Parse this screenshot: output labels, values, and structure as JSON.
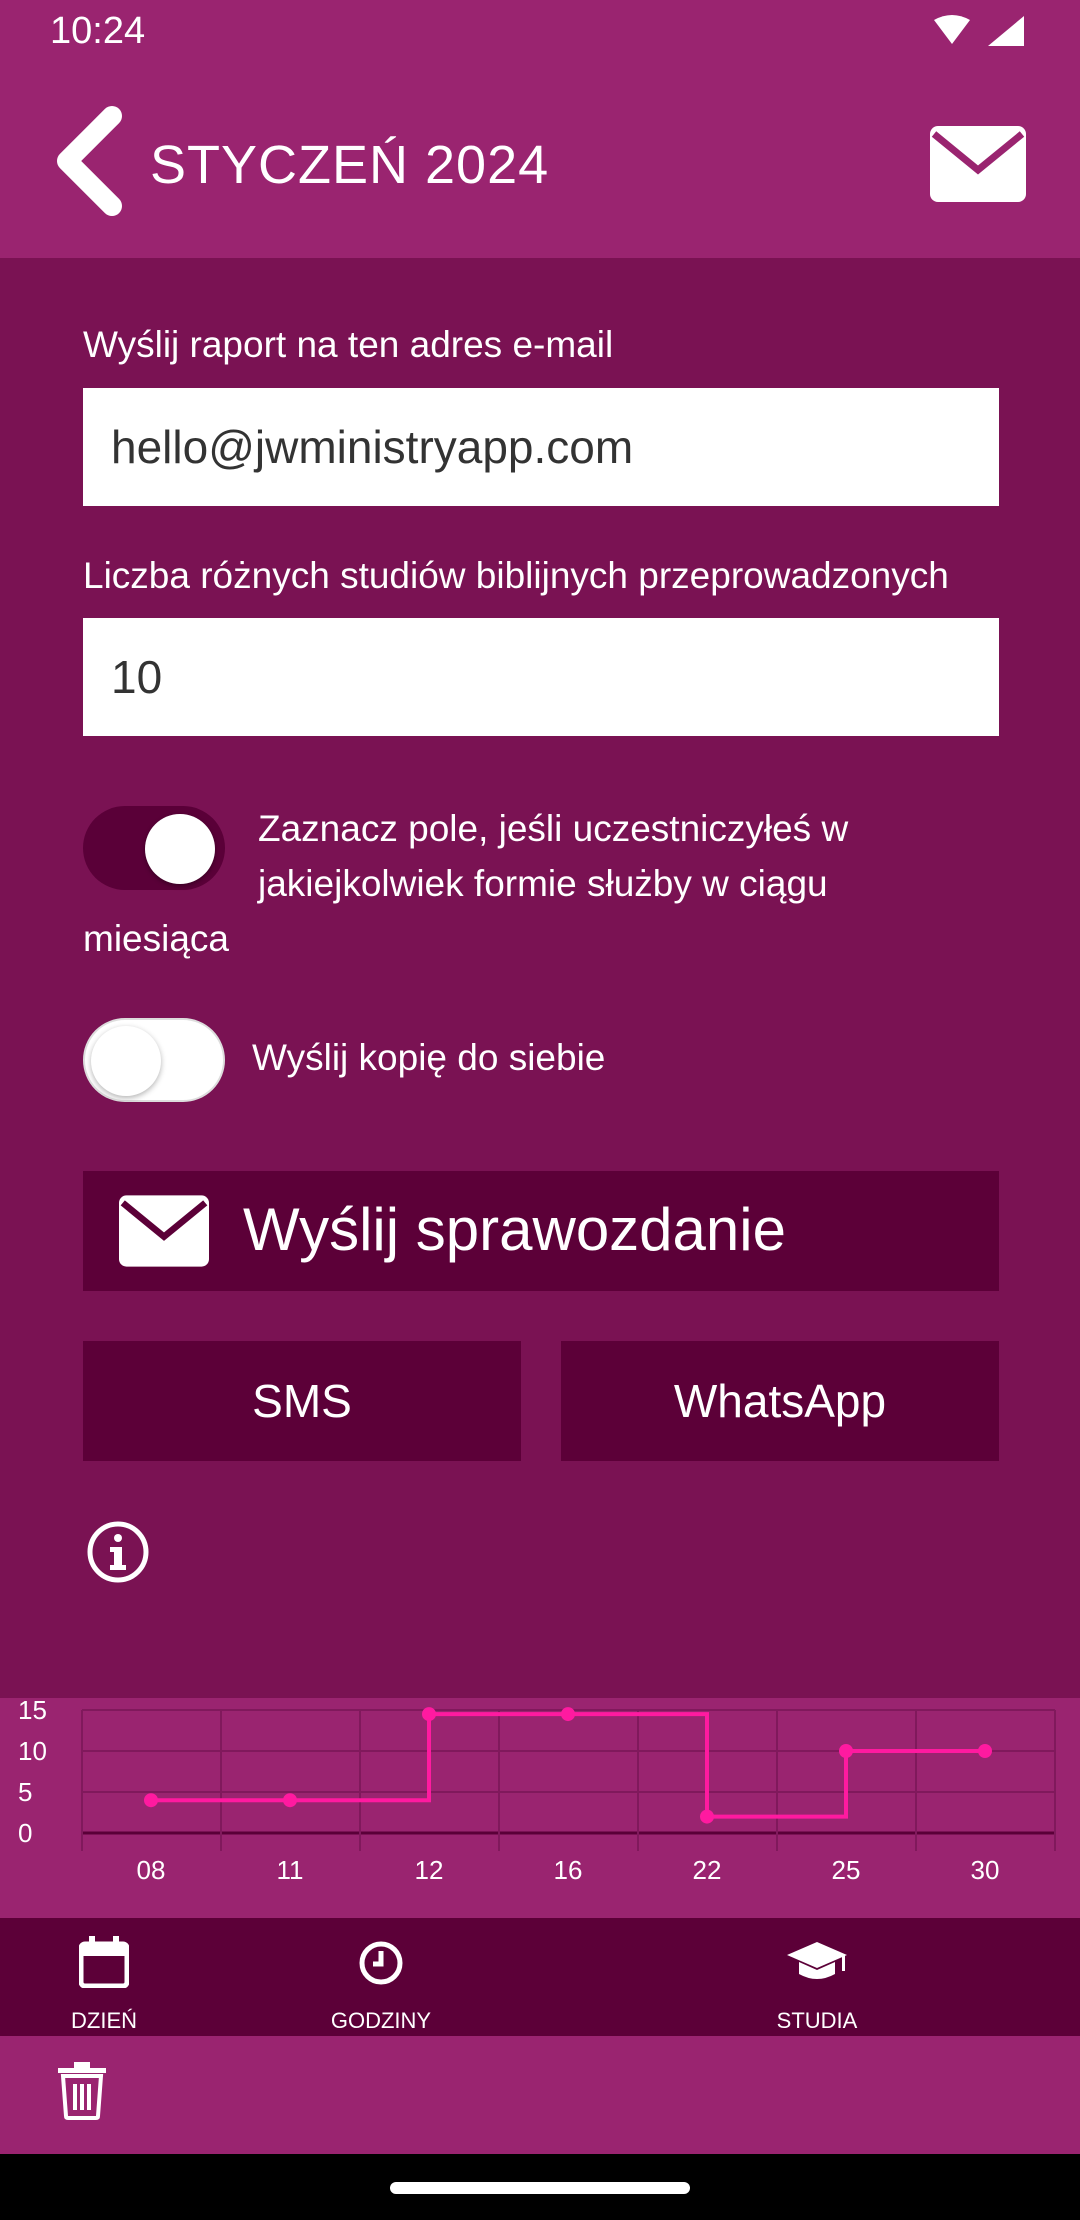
{
  "status_bar": {
    "time": "10:24"
  },
  "header": {
    "title": "STYCZEŃ 2024",
    "back_icon": "chevron-left-icon",
    "mail_icon": "envelope-icon"
  },
  "form": {
    "email_label": "Wyślij raport na ten adres e-mail",
    "email_value": "hello@jwministryapp.com",
    "studies_label": "Liczba różnych studiów biblijnych przeprowadzonych",
    "studies_value": "10",
    "participated_toggle": {
      "on": true,
      "label_line1": "Zaznacz pole, jeśli uczestniczyłeś w",
      "label_line2": "jakiejkolwiek formie służby w ciągu",
      "label_line3": "miesiąca"
    },
    "copy_toggle": {
      "on": false,
      "label": "Wyślij kopię do siebie"
    }
  },
  "actions": {
    "send_label": "Wyślij sprawozdanie",
    "sms_label": "SMS",
    "whatsapp_label": "WhatsApp"
  },
  "chart_data": {
    "type": "line",
    "step": true,
    "x": [
      "08",
      "11",
      "12",
      "16",
      "22",
      "25",
      "30"
    ],
    "series": [
      {
        "values": [
          4,
          4,
          14.5,
          14.5,
          2,
          10,
          10
        ]
      }
    ],
    "ylim": [
      0,
      15
    ],
    "yticks": [
      "15",
      "10",
      "5",
      "0"
    ],
    "grid": true,
    "colors": {
      "line": "#ff1aa0",
      "background": "#9a2470",
      "grid": "#80195c",
      "axis": "#5a0038"
    }
  },
  "bottom_nav": {
    "items": [
      {
        "label": "DZIEŃ",
        "icon": "calendar-icon"
      },
      {
        "label": "GODZINY",
        "icon": "clock-icon"
      },
      {
        "label": "STUDIA BIBLIJNE",
        "icon": "graduation-cap-icon"
      }
    ]
  },
  "colors": {
    "app_bar": "#9a2470",
    "content_bg": "#7a1253",
    "button_bg": "#5c0038"
  }
}
